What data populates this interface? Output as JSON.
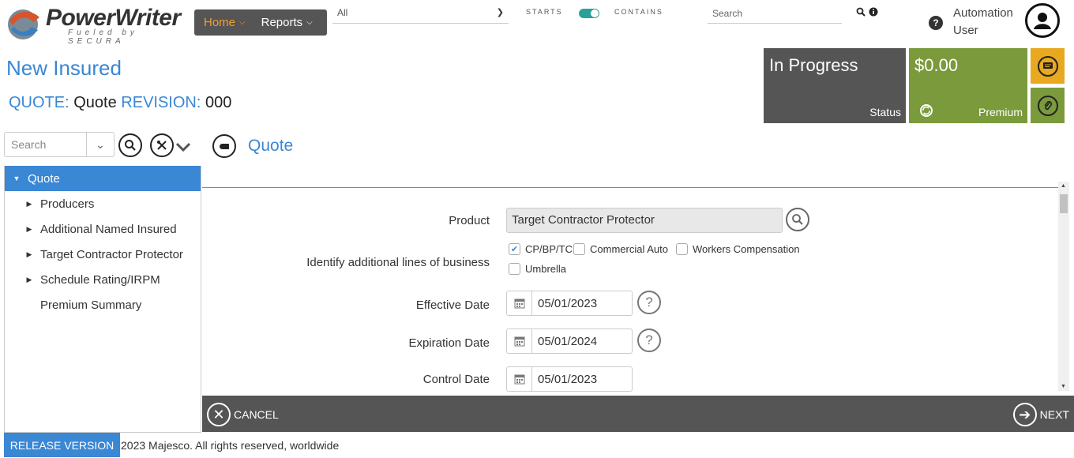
{
  "brand": {
    "name": "PowerWriter",
    "tagline": "Fueled by SECURA"
  },
  "nav": {
    "home": "Home",
    "reports": "Reports"
  },
  "search_scope": {
    "value": "All"
  },
  "toggle": {
    "left": "STARTS",
    "right": "CONTAINS"
  },
  "header_search": {
    "placeholder": "Search"
  },
  "user": {
    "first": "Automation",
    "last": "User"
  },
  "page": {
    "title": "New Insured",
    "quote_key": "QUOTE:",
    "quote_val": "Quote",
    "rev_key": "REVISION:",
    "rev_val": "000"
  },
  "tiles": {
    "status_value": "In Progress",
    "status_label": "Status",
    "premium_value": "$0.00",
    "premium_label": "Premium"
  },
  "sidebar": {
    "search_placeholder": "Search",
    "items": [
      {
        "label": "Quote",
        "expanded": true,
        "selected": true
      },
      {
        "label": "Producers"
      },
      {
        "label": "Additional Named Insured"
      },
      {
        "label": "Target Contractor Protector"
      },
      {
        "label": "Schedule Rating/IRPM"
      },
      {
        "label": "Premium Summary"
      }
    ]
  },
  "section": {
    "title": "Quote"
  },
  "form": {
    "product_label": "Product",
    "product_value": "Target Contractor Protector",
    "lines_label": "Identify additional lines of business",
    "lines": [
      {
        "label": "CP/BP/TC",
        "checked": true
      },
      {
        "label": "Commercial Auto",
        "checked": false
      },
      {
        "label": "Workers Compensation",
        "checked": false
      },
      {
        "label": "Umbrella",
        "checked": false
      }
    ],
    "effective_label": "Effective Date",
    "effective_value": "05/01/2023",
    "expiration_label": "Expiration Date",
    "expiration_value": "05/01/2024",
    "control_label": "Control Date",
    "control_value": "05/01/2023"
  },
  "actions": {
    "cancel": "CANCEL",
    "next": "NEXT"
  },
  "footer": {
    "release": "RELEASE VERSION",
    "copyright": "2023 Majesco. All rights reserved, worldwide"
  }
}
